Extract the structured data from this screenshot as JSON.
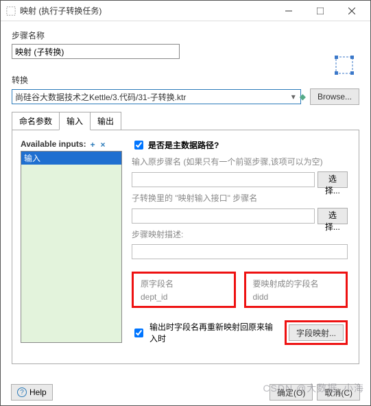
{
  "window": {
    "title": "映射 (执行子转换任务)"
  },
  "step_name": {
    "label": "步骤名称",
    "value": "映射 (子转换)"
  },
  "transform": {
    "label": "转换",
    "value": "尚硅谷大数据技术之Kettle/3.代码/31-子转换.ktr",
    "browse_label": "Browse..."
  },
  "tabs": {
    "params": "命名参数",
    "input": "输入",
    "output": "输出"
  },
  "input_tab": {
    "available_label": "Available inputs:",
    "selected_item": "输入",
    "main_path_label": "是否是主数据路径?",
    "main_path_checked": true,
    "orig_step_label": "输入原步骤名 (如果只有一个前驱步骤,该项可以为空)",
    "select_btn": "选择...",
    "sub_step_label": "子转换里的 \"映射输入接口\" 步骤名",
    "desc_label": "步骤映射描述:",
    "orig_field": {
      "label": "原字段名",
      "value": "dept_id"
    },
    "target_field": {
      "label": "要映射成的字段名",
      "value": "didd"
    },
    "rename_back_label": "输出时字段名再重新映射回原来输入时",
    "rename_back_checked": true,
    "field_mapping_btn": "字段映射..."
  },
  "footer": {
    "help": "Help",
    "ok": "确定(O)",
    "cancel": "取消(C)"
  },
  "watermark": "CSDN @大数据_小海"
}
